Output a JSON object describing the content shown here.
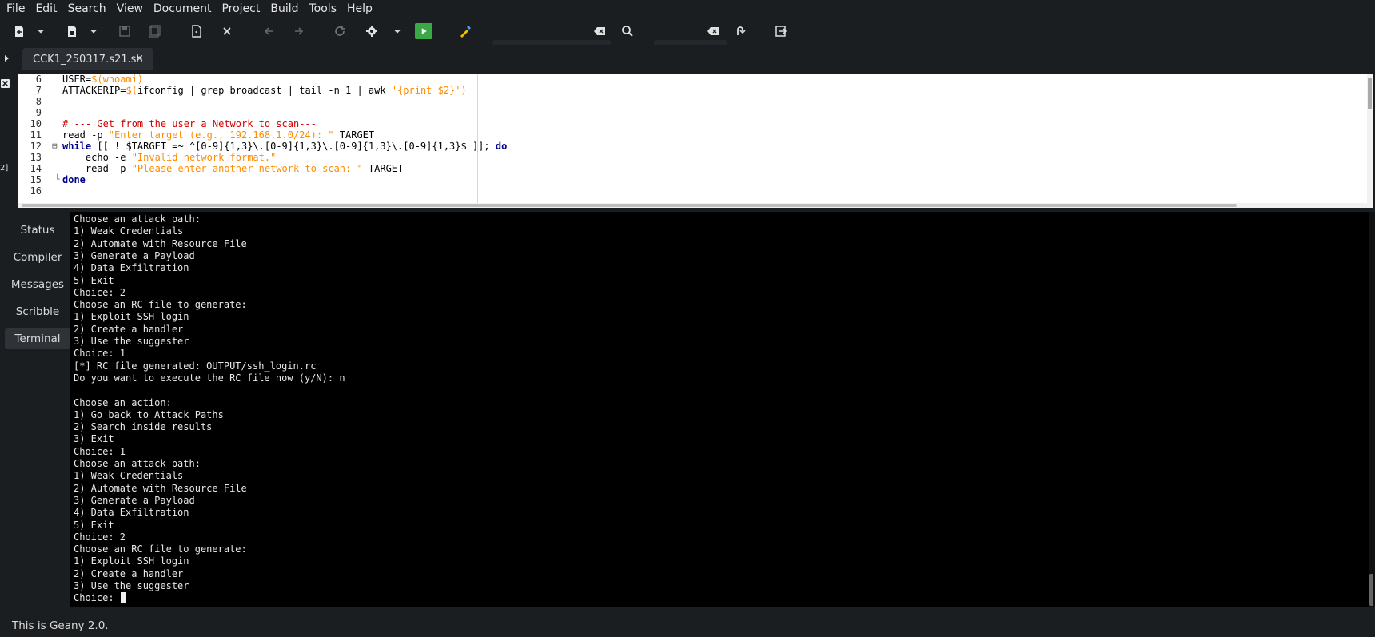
{
  "menu": [
    "File",
    "Edit",
    "Search",
    "View",
    "Document",
    "Project",
    "Build",
    "Tools",
    "Help"
  ],
  "toolbar": {
    "search_value": "",
    "goto_value": "",
    "icons": [
      "new-file-icon",
      "new-dropdown-icon",
      "open-file-icon",
      "open-dropdown-icon",
      "save-icon",
      "save-all-icon",
      "revert-icon",
      "close-icon",
      "nav-back-icon",
      "nav-forward-icon",
      "reload-icon",
      "build-gear-icon",
      "build-dropdown-icon",
      "run-icon",
      "color-picker-icon",
      "clear-search-icon",
      "search-icon",
      "clear-goto-icon",
      "goto-line-icon",
      "quit-icon"
    ]
  },
  "tab": {
    "label": "CCK1_250317.s21.sh",
    "close": "×"
  },
  "editor": {
    "line_numbers": [
      "6",
      "7",
      "8",
      "9",
      "10",
      "11",
      "12",
      "13",
      "14",
      "15",
      "16"
    ],
    "lines": [
      "USER=$(whoami)",
      "ATTACKERIP=$(ifconfig | grep broadcast | tail -n 1 | awk '{print $2}')",
      "",
      "",
      "# --- Get from the user a Network to scan---",
      "read -p \"Enter target (e.g., 192.168.1.0/24): \" TARGET",
      "while [[ ! $TARGET =~ ^[0-9]{1,3}\\.[0-9]{1,3}\\.[0-9]{1,3}\\.[0-9]{1,3}$ ]]; do",
      "    echo -e \"Invalid network format.\"",
      "    read -p \"Please enter another network to scan: \" TARGET",
      "done",
      ""
    ]
  },
  "sidebar": {
    "tabs": [
      "Status",
      "Compiler",
      "Messages",
      "Scribble",
      "Terminal"
    ],
    "active": "Terminal"
  },
  "left_gutter": {
    "marker": "2]"
  },
  "terminal": {
    "lines": [
      "Choose an attack path:",
      "1) Weak Credentials",
      "2) Automate with Resource File",
      "3) Generate a Payload",
      "4) Data Exfiltration",
      "5) Exit",
      "Choice: 2",
      "Choose an RC file to generate:",
      "1) Exploit SSH login",
      "2) Create a handler",
      "3) Use the suggester",
      "Choice: 1",
      "[*] RC file generated: OUTPUT/ssh_login.rc",
      "Do you want to execute the RC file now (y/N): n",
      "",
      "Choose an action:",
      "1) Go back to Attack Paths",
      "2) Search inside results",
      "3) Exit",
      "Choice: 1",
      "Choose an attack path:",
      "1) Weak Credentials",
      "2) Automate with Resource File",
      "3) Generate a Payload",
      "4) Data Exfiltration",
      "5) Exit",
      "Choice: 2",
      "Choose an RC file to generate:",
      "1) Exploit SSH login",
      "2) Create a handler",
      "3) Use the suggester",
      "Choice: "
    ]
  },
  "status": {
    "text": "This is Geany 2.0."
  },
  "colors": {
    "background": "#1b1e21",
    "editor_bg": "#ffffff",
    "terminal_bg": "#000000",
    "run_green": "#3aa845"
  }
}
